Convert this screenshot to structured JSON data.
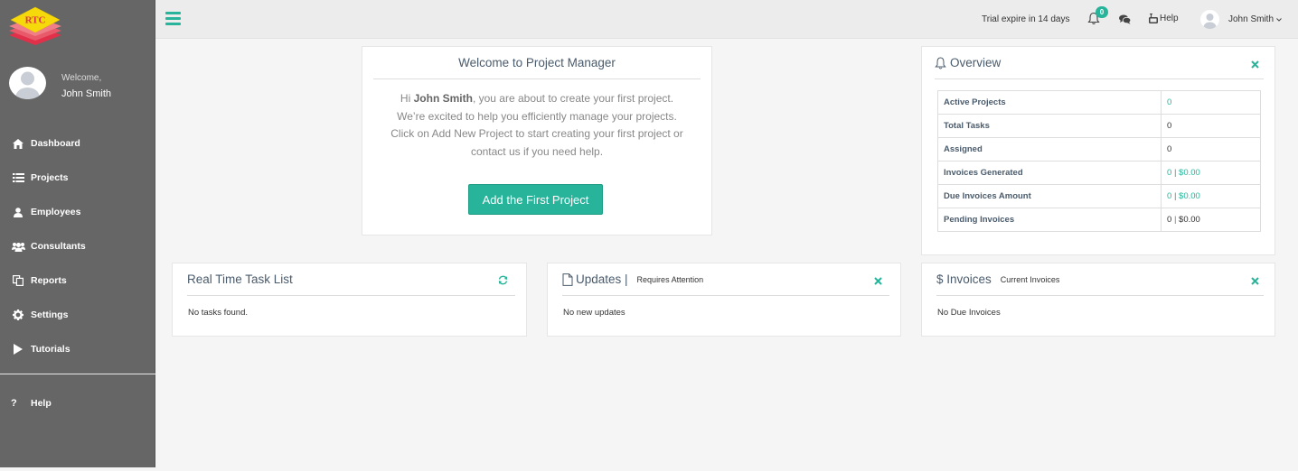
{
  "brand": {
    "logo_text": "RTC"
  },
  "sidebar": {
    "welcome": "Welcome,",
    "user_name": "John Smith",
    "items": [
      {
        "label": "Dashboard",
        "icon": "home-icon"
      },
      {
        "label": "Projects",
        "icon": "list-icon"
      },
      {
        "label": "Employees",
        "icon": "user-icon"
      },
      {
        "label": "Consultants",
        "icon": "users-icon"
      },
      {
        "label": "Reports",
        "icon": "copy-icon"
      },
      {
        "label": "Settings",
        "icon": "gear-icon"
      },
      {
        "label": "Tutorials",
        "icon": "play-icon"
      }
    ],
    "help_label": "Help",
    "help_icon": "?"
  },
  "topbar": {
    "trial_text": "Trial expire in 14 days",
    "notification_count": "0",
    "help_label": "Help",
    "user_name": "John Smith"
  },
  "welcome_panel": {
    "title": "Welcome to Project Manager",
    "greeting": "Hi",
    "name": "John Smith",
    "line1_rest": ", you are about to create your first project.",
    "line2": "We’re excited to help you efficiently manage your projects.",
    "line3": "Click on Add New Project to start creating your first project or",
    "line4": "contact us if you need help.",
    "button_label": "Add the First Project"
  },
  "overview": {
    "title": "Overview",
    "rows": [
      {
        "label": "Active Projects",
        "value": "0"
      },
      {
        "label": "Total Tasks",
        "value": "0"
      },
      {
        "label": "Assigned",
        "value": "0"
      },
      {
        "label": "Invoices Generated",
        "count": "0",
        "sep": "|",
        "amount": "$0.00"
      },
      {
        "label": "Due Invoices Amount",
        "count": "0",
        "sep": "|",
        "amount": "$0.00"
      },
      {
        "label": "Pending Invoices",
        "count": "0",
        "sep": "|",
        "amount": "$0.00"
      }
    ]
  },
  "tasks_panel": {
    "title": "Real Time Task List",
    "empty": "No tasks found."
  },
  "updates_panel": {
    "title": "Updates |",
    "subtitle": "Requires Attention",
    "empty": "No new updates"
  },
  "invoices_panel": {
    "title": "$ Invoices",
    "subtitle": "Current Invoices",
    "empty": "No Due Invoices"
  },
  "colors": {
    "accent": "#27b49a",
    "sidebar": "#666666",
    "logo_yellow": "#f5d90a",
    "logo_red": "#e0304a"
  }
}
